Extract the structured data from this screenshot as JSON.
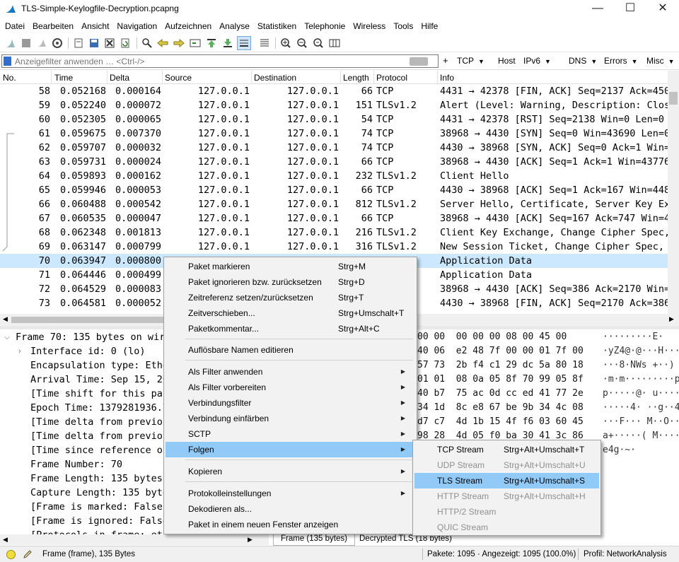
{
  "window": {
    "title": "TLS-Simple-Keylogfile-Decryption.pcapng",
    "minimize": "—",
    "maximize": "☐",
    "close": "✕"
  },
  "menu": [
    "Datei",
    "Bearbeiten",
    "Ansicht",
    "Navigation",
    "Aufzeichnen",
    "Analyse",
    "Statistiken",
    "Telephonie",
    "Wireless",
    "Tools",
    "Hilfe"
  ],
  "filter": {
    "placeholder": "Anzeigefilter anwenden … <Ctrl-/>",
    "plus": "+",
    "buttons": [
      "TCP",
      "Host",
      "IPv6",
      "DNS",
      "Errors",
      "Misc"
    ]
  },
  "packet_list": {
    "columns": [
      "No.",
      "Time",
      "Delta",
      "Source",
      "Destination",
      "Length",
      "Protocol",
      "Info"
    ],
    "rows": [
      {
        "no": "58",
        "time": "0.052168",
        "delta": "0.000164",
        "src": "127.0.0.1",
        "dst": "127.0.0.1",
        "len": "66",
        "proto": "TCP",
        "info": "4431 → 42378 [FIN, ACK] Seq=2137 Ack=450"
      },
      {
        "no": "59",
        "time": "0.052240",
        "delta": "0.000072",
        "src": "127.0.0.1",
        "dst": "127.0.0.1",
        "len": "151",
        "proto": "TLSv1.2",
        "info": "Alert (Level: Warning, Description: Clos"
      },
      {
        "no": "60",
        "time": "0.052305",
        "delta": "0.000065",
        "src": "127.0.0.1",
        "dst": "127.0.0.1",
        "len": "54",
        "proto": "TCP",
        "info": "4431 → 42378 [RST] Seq=2138 Win=0 Len=0"
      },
      {
        "no": "61",
        "time": "0.059675",
        "delta": "0.007370",
        "src": "127.0.0.1",
        "dst": "127.0.0.1",
        "len": "74",
        "proto": "TCP",
        "info": "38968 → 4430 [SYN] Seq=0 Win=43690 Len=0"
      },
      {
        "no": "62",
        "time": "0.059707",
        "delta": "0.000032",
        "src": "127.0.0.1",
        "dst": "127.0.0.1",
        "len": "74",
        "proto": "TCP",
        "info": "4430 → 38968 [SYN, ACK] Seq=0 Ack=1 Win="
      },
      {
        "no": "63",
        "time": "0.059731",
        "delta": "0.000024",
        "src": "127.0.0.1",
        "dst": "127.0.0.1",
        "len": "66",
        "proto": "TCP",
        "info": "38968 → 4430 [ACK] Seq=1 Ack=1 Win=43776"
      },
      {
        "no": "64",
        "time": "0.059893",
        "delta": "0.000162",
        "src": "127.0.0.1",
        "dst": "127.0.0.1",
        "len": "232",
        "proto": "TLSv1.2",
        "info": "Client Hello"
      },
      {
        "no": "65",
        "time": "0.059946",
        "delta": "0.000053",
        "src": "127.0.0.1",
        "dst": "127.0.0.1",
        "len": "66",
        "proto": "TCP",
        "info": "4430 → 38968 [ACK] Seq=1 Ack=167 Win=448"
      },
      {
        "no": "66",
        "time": "0.060488",
        "delta": "0.000542",
        "src": "127.0.0.1",
        "dst": "127.0.0.1",
        "len": "812",
        "proto": "TLSv1.2",
        "info": "Server Hello, Certificate, Server Key Ex"
      },
      {
        "no": "67",
        "time": "0.060535",
        "delta": "0.000047",
        "src": "127.0.0.1",
        "dst": "127.0.0.1",
        "len": "66",
        "proto": "TCP",
        "info": "38968 → 4430 [ACK] Seq=167 Ack=747 Win=4"
      },
      {
        "no": "68",
        "time": "0.062348",
        "delta": "0.001813",
        "src": "127.0.0.1",
        "dst": "127.0.0.1",
        "len": "216",
        "proto": "TLSv1.2",
        "info": "Client Key Exchange, Change Cipher Spec,"
      },
      {
        "no": "69",
        "time": "0.063147",
        "delta": "0.000799",
        "src": "127.0.0.1",
        "dst": "127.0.0.1",
        "len": "316",
        "proto": "TLSv1.2",
        "info": "New Session Ticket, Change Cipher Spec,"
      },
      {
        "no": "70",
        "time": "0.063947",
        "delta": "0.000800",
        "src": "",
        "dst": "",
        "len": "",
        "proto": "",
        "info": "Application Data"
      },
      {
        "no": "71",
        "time": "0.064446",
        "delta": "0.000499",
        "src": "",
        "dst": "",
        "len": "",
        "proto": "",
        "info": "Application Data"
      },
      {
        "no": "72",
        "time": "0.064529",
        "delta": "0.000083",
        "src": "",
        "dst": "",
        "len": "",
        "proto": "",
        "info": "38968 → 4430 [ACK] Seq=386 Ack=2170 Win="
      },
      {
        "no": "73",
        "time": "0.064581",
        "delta": "0.000052",
        "src": "",
        "dst": "",
        "len": "",
        "proto": "",
        "info": "4430 → 38968 [FIN, ACK] Seq=2170 Ack=386"
      }
    ]
  },
  "details": [
    "Frame 70: 135 bytes on wir",
    "Interface id: 0 (lo)",
    "Encapsulation type: Ethe",
    "Arrival Time: Sep 15, 20",
    "[Time shift for this pac",
    "Epoch Time: 1379281936.7",
    "[Time delta from previou",
    "[Time delta from previou",
    "[Time since reference or",
    "Frame Number: 70",
    "Frame Length: 135 bytes",
    "Capture Length: 135 byte",
    "[Frame is marked: False]",
    "[Frame is ignored: False",
    "[Protocols in frame: eth"
  ],
  "bytes": [
    {
      "hex": "00 00  00 00 00 08 00 45 00",
      "ascii": "·········E·"
    },
    {
      "hex": "40 06  e2 48 7f 00 00 01 7f 00",
      "ascii": "·yZ4@·@···H···"
    },
    {
      "hex": "57 73  2b f4 c1 29 dc 5a 80 18",
      "ascii": "···8·NWs +··)"
    },
    {
      "hex": "01 01  08 0a 05 8f 70 99 05 8f",
      "ascii": "·m·m·········p"
    },
    {
      "hex": "40 b7  75 ac 0d cc ed 41 77 2e",
      "ascii": "p·····@· u····"
    },
    {
      "hex": "34 1d  8c e8 67 be 9b 34 4c 08",
      "ascii": "·····4· ··g··4"
    },
    {
      "hex": "d7 c7  4d 1b 15 4f f6 03 60 45",
      "ascii": "···F··· M··O··"
    },
    {
      "hex": "98 28  4d 05 f0 ba 30 41 3c 86",
      "ascii": "a+·····( M····"
    },
    {
      "hex": "",
      "ascii": "e4g·~·"
    }
  ],
  "byte_tabs": [
    "Frame (135 bytes)",
    "Decrypted TLS (18 bytes)"
  ],
  "status": {
    "frame": "Frame (frame), 135 Bytes",
    "packets": "Pakete: 1095 · Angezeigt: 1095 (100.0%)",
    "profile": "Profil: NetworkAnalysis"
  },
  "context_menu": {
    "items": [
      {
        "label": "Paket markieren",
        "shortcut": "Strg+M"
      },
      {
        "label": "Paket ignorieren bzw. zurücksetzen",
        "shortcut": "Strg+D"
      },
      {
        "label": "Zeitreferenz setzen/zurücksetzen",
        "shortcut": "Strg+T"
      },
      {
        "label": "Zeitverschieben...",
        "shortcut": "Strg+Umschalt+T"
      },
      {
        "label": "Paketkommentar...",
        "shortcut": "Strg+Alt+C"
      },
      {
        "label": "Auflösbare Namen editieren",
        "shortcut": ""
      },
      {
        "label": "Als Filter anwenden",
        "shortcut": ""
      },
      {
        "label": "Als Filter vorbereiten",
        "shortcut": ""
      },
      {
        "label": "Verbindungsfilter",
        "shortcut": ""
      },
      {
        "label": "Verbindung einfärben",
        "shortcut": ""
      },
      {
        "label": "SCTP",
        "shortcut": ""
      },
      {
        "label": "Folgen",
        "shortcut": ""
      },
      {
        "label": "Kopieren",
        "shortcut": ""
      },
      {
        "label": "Protokolleinstellungen",
        "shortcut": ""
      },
      {
        "label": "Dekodieren als...",
        "shortcut": ""
      },
      {
        "label": "Paket in einem neuen Fenster anzeigen",
        "shortcut": ""
      }
    ],
    "arrow": "▶"
  },
  "submenu": {
    "items": [
      {
        "label": "TCP Stream",
        "shortcut": "Strg+Alt+Umschalt+T"
      },
      {
        "label": "UDP Stream",
        "shortcut": "Strg+Alt+Umschalt+U"
      },
      {
        "label": "TLS Stream",
        "shortcut": "Strg+Alt+Umschalt+S"
      },
      {
        "label": "HTTP Stream",
        "shortcut": "Strg+Alt+Umschalt+H"
      },
      {
        "label": "HTTP/2 Stream",
        "shortcut": ""
      },
      {
        "label": "QUIC Stream",
        "shortcut": ""
      }
    ]
  },
  "colors": {
    "selection": "#cce8ff",
    "menu_highlight": "#91c9f7",
    "disabled_text": "#8f8f8f"
  }
}
